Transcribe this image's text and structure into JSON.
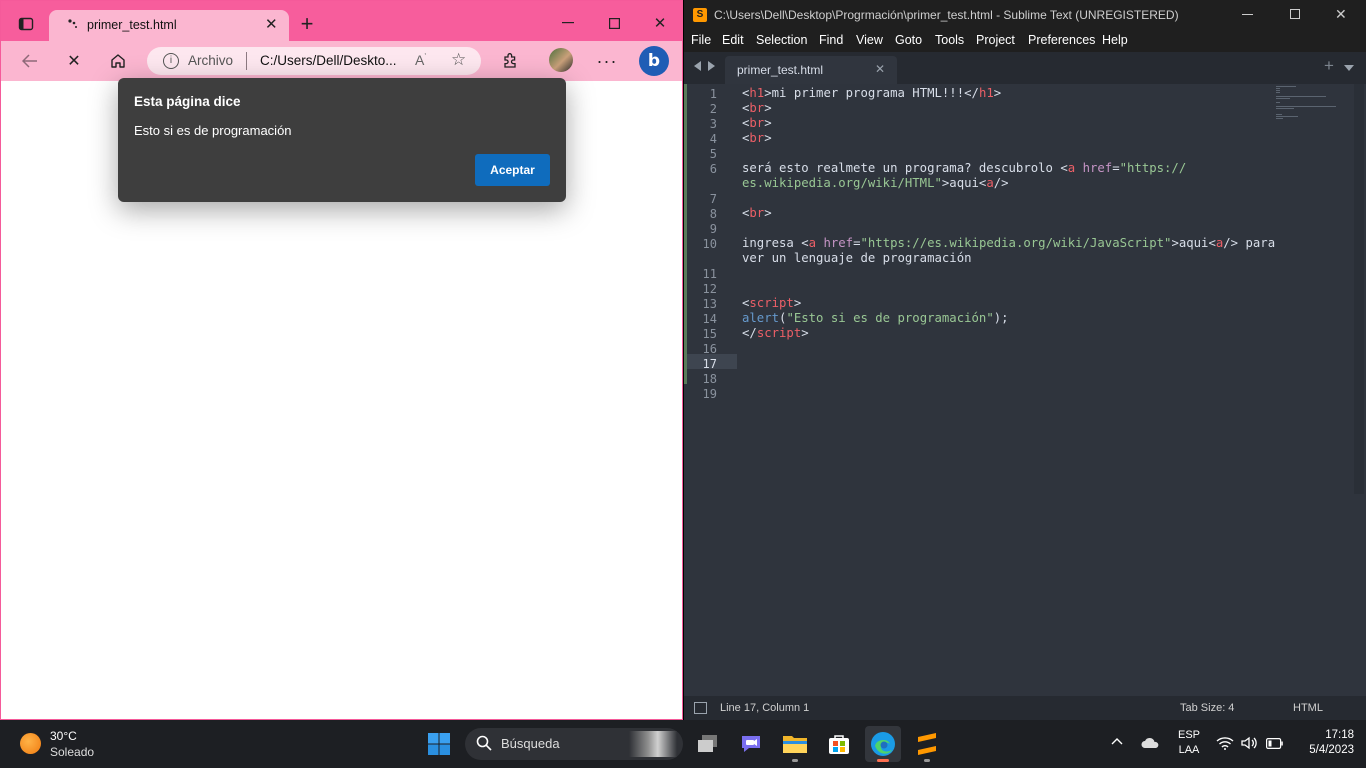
{
  "browser": {
    "tab_title": "primer_test.html",
    "omnibox": {
      "chip": "Archivo",
      "url": "C:/Users/Dell/Deskto..."
    },
    "dialog": {
      "title": "Esta página dice",
      "message": "Esto si es de programación",
      "ok_label": "Aceptar"
    }
  },
  "sublime": {
    "window_title": "C:\\Users\\Dell\\Desktop\\Progrmación\\primer_test.html - Sublime Text (UNREGISTERED)",
    "menu": [
      "File",
      "Edit",
      "Selection",
      "Find",
      "View",
      "Goto",
      "Tools",
      "Project",
      "Preferences",
      "Help"
    ],
    "tab_label": "primer_test.html",
    "line_numbers": [
      "1",
      "2",
      "3",
      "4",
      "5",
      "6",
      "",
      "7",
      "8",
      "9",
      "10",
      "",
      "11",
      "12",
      "13",
      "14",
      "15",
      "16",
      "17",
      "18",
      "19"
    ],
    "code": {
      "l1": [
        "<",
        "h1",
        ">",
        "mi primer programa HTML!!!",
        "</",
        "h1",
        ">"
      ],
      "br": [
        "<",
        "br",
        ">"
      ],
      "l6a": [
        "será esto realmete un programa? descubrolo ",
        "<",
        "a",
        " ",
        "href",
        "=",
        "\"https://"
      ],
      "l6b": [
        "es.wikipedia.org/wiki/HTML\"",
        ">",
        "aqui",
        "<",
        "a",
        "/>"
      ],
      "l10a": [
        "ingresa ",
        "<",
        "a",
        " ",
        "href",
        "=",
        "\"https://es.wikipedia.org/wiki/JavaScript\"",
        ">",
        "aqui",
        "<",
        "a",
        "/>",
        " para"
      ],
      "l10b": "ver un lenguaje de programación",
      "l13": [
        "<",
        "script",
        ">"
      ],
      "l14": [
        "alert",
        "(",
        "\"Esto si es de programación\"",
        ");"
      ],
      "l15": [
        "</",
        "script",
        ">"
      ]
    },
    "status": {
      "position": "Line 17, Column 1",
      "tab_size": "Tab Size: 4",
      "syntax": "HTML"
    }
  },
  "taskbar": {
    "weather": {
      "temp": "30°C",
      "desc": "Soleado"
    },
    "search_placeholder": "Búsqueda",
    "lang": {
      "top": "ESP",
      "bottom": "LAA"
    },
    "clock": {
      "time": "17:18",
      "date": "5/4/2023"
    }
  },
  "colors": {
    "browser_frame": "#f75d9c",
    "toolbar": "#fbb6d0",
    "sublime_bg": "#2f343d",
    "dialog_button": "#0f6cbd"
  }
}
